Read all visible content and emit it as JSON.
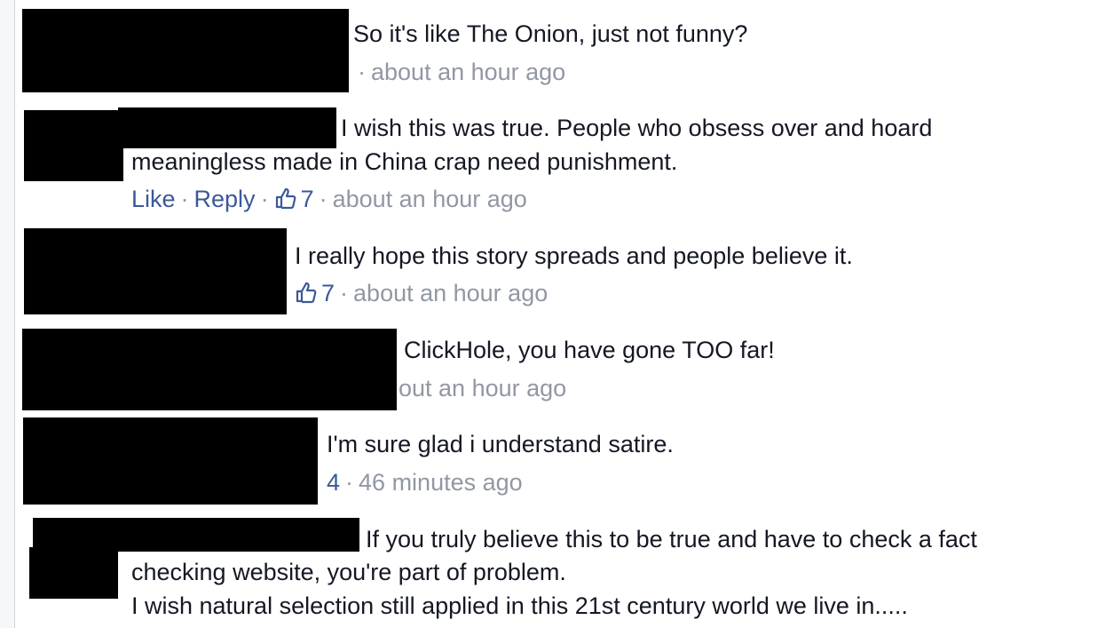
{
  "comments": [
    {
      "text_lines": [
        "So it's like The Onion, just not funny?"
      ],
      "timestamp": "about an hour ago"
    },
    {
      "text_lines": [
        "I wish this was true. People who obsess over and hoard",
        "meaningless made in China crap need punishment."
      ],
      "like_label": "Like",
      "reply_label": "Reply",
      "likes": "7",
      "timestamp": "about an hour ago",
      "like_icon": "thumbs-up-icon"
    },
    {
      "text_lines": [
        "I really hope this story spreads and people believe it."
      ],
      "likes": "7",
      "timestamp": "about an hour ago",
      "like_icon": "thumbs-up-icon"
    },
    {
      "text_lines": [
        "ClickHole, you have gone TOO far!"
      ],
      "timestamp": "out an hour ago"
    },
    {
      "text_lines": [
        "I'm sure glad i understand satire."
      ],
      "likes": "4",
      "timestamp": "46 minutes ago"
    },
    {
      "text_lines": [
        "If you truly believe this to be true and have to check a fact",
        "checking website, you're part of problem.",
        "I wish natural selection still applied in this 21st century world we live in....."
      ]
    }
  ],
  "colors": {
    "text": "#141823",
    "link": "#3b5998",
    "meta": "#9197a3",
    "redaction": "#000000",
    "background": "#ffffff"
  }
}
